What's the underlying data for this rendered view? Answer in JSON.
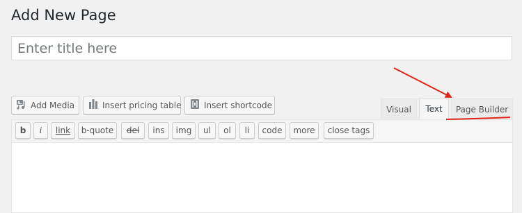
{
  "page": {
    "title": "Add New Page"
  },
  "title_field": {
    "placeholder": "Enter title here",
    "value": ""
  },
  "media_buttons": [
    {
      "label": "Add Media",
      "icon": "media-icon"
    },
    {
      "label": "Insert pricing table",
      "icon": "bar-chart-icon"
    },
    {
      "label": "Insert shortcode",
      "icon": "shortcode-icon"
    }
  ],
  "editor_tabs": [
    {
      "label": "Visual",
      "active": false
    },
    {
      "label": "Text",
      "active": true
    },
    {
      "label": "Page Builder",
      "active": false
    }
  ],
  "quicktags": [
    "b",
    "i",
    "link",
    "b-quote",
    "del",
    "ins",
    "img",
    "ul",
    "ol",
    "li",
    "code",
    "more",
    "close tags"
  ],
  "content": {
    "value": ""
  },
  "annotation": {
    "color": "#e2231a"
  }
}
